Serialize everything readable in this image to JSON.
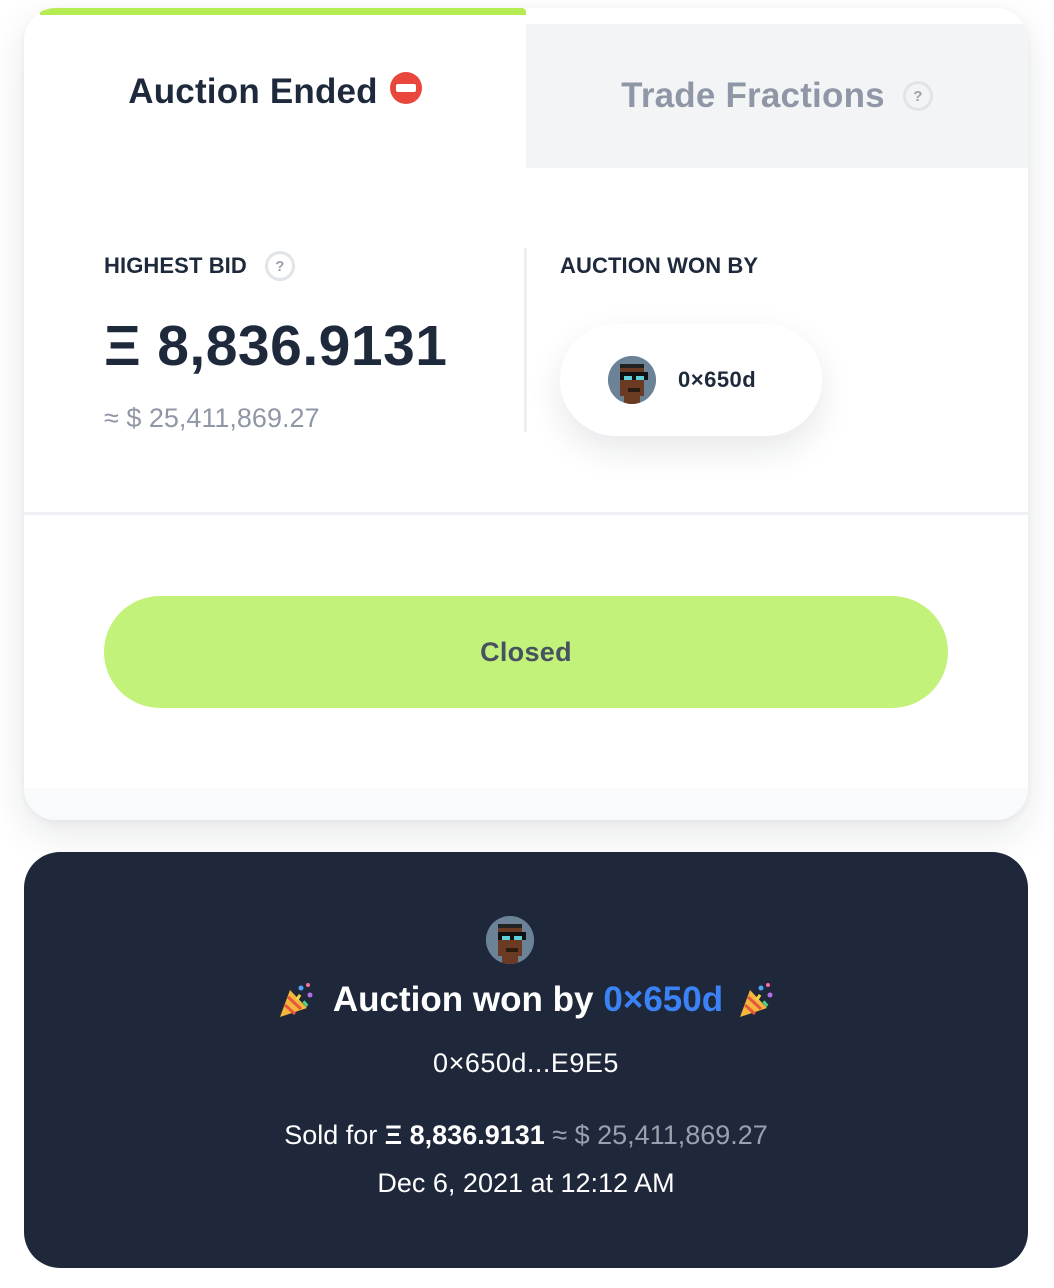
{
  "tabs": {
    "auction": {
      "label": "Auction Ended",
      "icon": "no-entry-icon",
      "active": true
    },
    "trade": {
      "label": "Trade Fractions",
      "help_icon": "question-icon",
      "active": false
    }
  },
  "bid": {
    "label": "HIGHEST BID",
    "help_icon": "question-icon",
    "eth_symbol": "Ξ",
    "eth_value": "8,836.9131",
    "usd_value": "≈ $ 25,411,869.27"
  },
  "winner": {
    "label": "AUCTION WON BY",
    "avatar_icon": "punk-avatar-icon",
    "short_address": "0×650d"
  },
  "action": {
    "button_label": "Closed"
  },
  "result": {
    "avatar_icon": "punk-avatar-icon",
    "party_icon": "party-popper-icon",
    "won_by_text": "Auction won by",
    "winner_short": "0×650d",
    "winner_full": "0×650d...E9E5",
    "sold_prefix": "Sold for",
    "sold_eth": "Ξ 8,836.9131",
    "sold_usd": "≈ $ 25,411,869.27",
    "date": "Dec 6, 2021 at 12:12 AM"
  },
  "colors": {
    "accent_green": "#c2f27a",
    "progress_green": "#b4ec51",
    "dark_bg": "#1f273a",
    "link_blue": "#3b82f6",
    "text_dark": "#1e293b",
    "text_muted": "#8f97a6"
  }
}
